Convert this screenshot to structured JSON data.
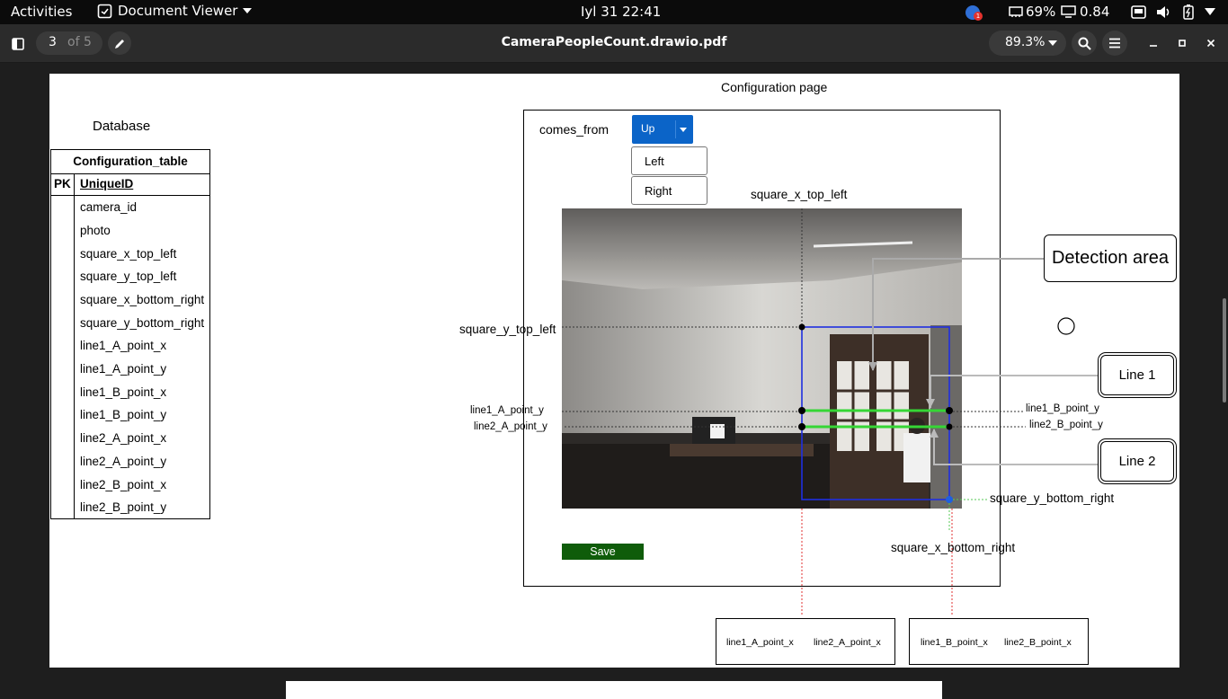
{
  "topbar": {
    "activities": "Activities",
    "app_name": "Document Viewer",
    "clock": "Iyl 31  22:41",
    "battery": "69%",
    "load": "0.84",
    "notification_count": "1"
  },
  "headerbar": {
    "current_page": "3",
    "page_total": "of 5",
    "doc_title": "CameraPeopleCount.drawio.pdf",
    "zoom": "89.3%"
  },
  "database": {
    "heading": "Database",
    "table_name": "Configuration_table",
    "pk_label": "PK",
    "pk_field": "UniqueID",
    "fields": [
      "camera_id",
      "photo",
      "square_x_top_left",
      "square_y_top_left",
      "square_x_bottom_right",
      "square_y_bottom_right",
      "line1_A_point_x",
      "line1_A_point_y",
      "line1_B_point_x",
      "line1_B_point_y",
      "line2_A_point_x",
      "line2_A_point_y",
      "line2_B_point_x",
      "line2_B_point_y"
    ]
  },
  "config": {
    "title": "Configuration page",
    "comes_from_label": "comes_from",
    "selected": "Up",
    "options": [
      "Left",
      "Right"
    ],
    "save_label": "Save",
    "accent": "#0b64c8",
    "save_color": "#0f5c0a"
  },
  "annotations": {
    "square_x_top_left": "square_x_top_left",
    "square_y_top_left": "square_y_top_left",
    "line1_A_point_y": "line1_A_point_y",
    "line2_A_point_y": "line2_A_point_y",
    "line1_B_point_y": "line1_B_point_y",
    "line2_B_point_y": "line2_B_point_y",
    "square_y_bottom_right": "square_y_bottom_right",
    "square_x_bottom_right": "square_x_bottom_right",
    "detection_area": "Detection area",
    "line1": "Line 1",
    "line2": "Line 2",
    "bottom_left_a": "line1_A_point_x",
    "bottom_left_b": "line2_A_point_x",
    "bottom_right_a": "line1_B_point_x",
    "bottom_right_b": "line2_B_point_x"
  }
}
